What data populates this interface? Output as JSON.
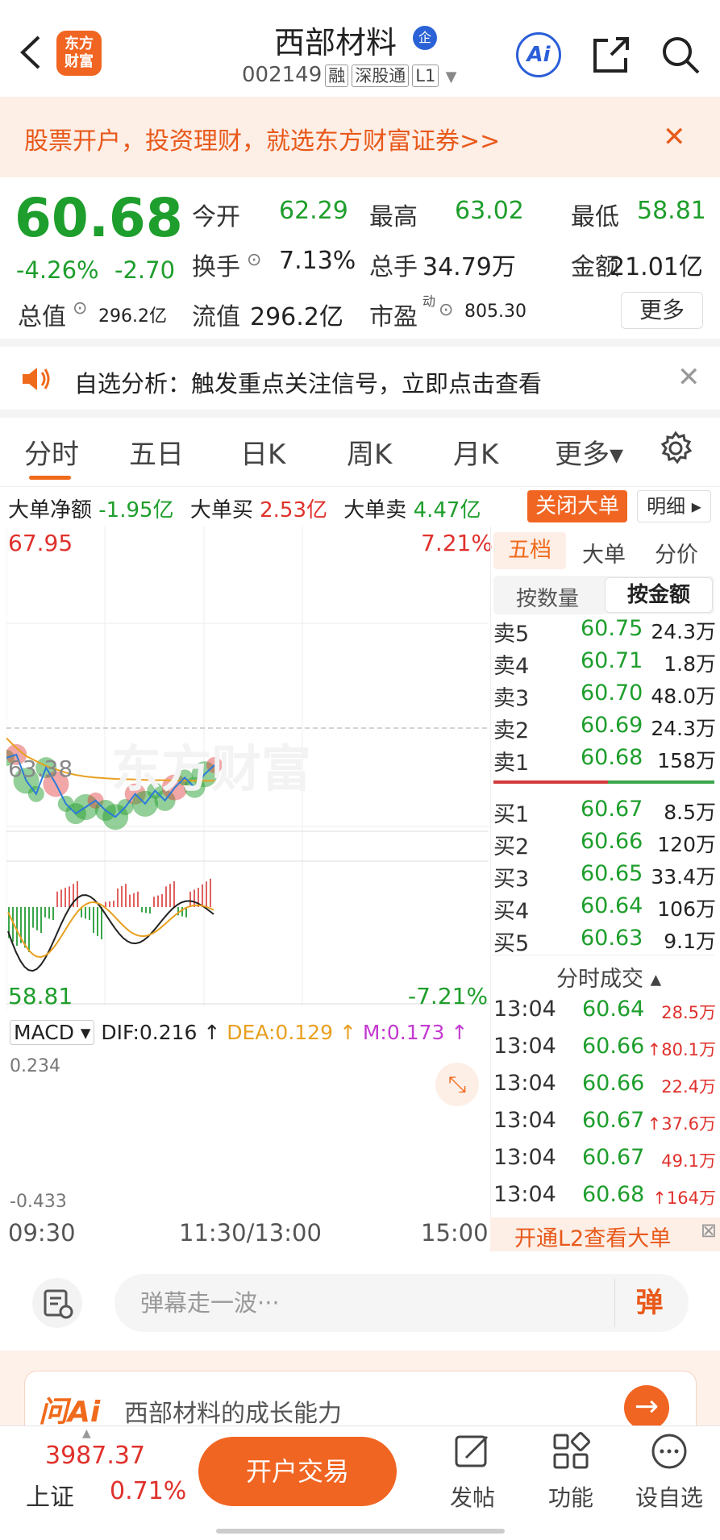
{
  "header": {
    "logo_line1": "东方",
    "logo_line2": "财富",
    "stock_name": "西部材料",
    "enterprise_badge": "企",
    "stock_code": "002149",
    "tags": [
      "融",
      "深股通",
      "L1"
    ],
    "ai_label": "Ai"
  },
  "promo": {
    "text": "股票开户，投资理财，就选东方财富证券>>",
    "close": "✕"
  },
  "quote": {
    "price": "60.68",
    "change_pct": "-4.26%",
    "change_abs": "-2.70",
    "open_label": "今开",
    "open": "62.29",
    "high_label": "最高",
    "high": "63.02",
    "low_label": "最低",
    "low": "58.81",
    "turnover_label": "换手",
    "turnover": "7.13%",
    "volume_label": "总手",
    "volume": "34.79万",
    "amount_label": "金额",
    "amount": "21.01亿",
    "mktcap_label": "总值",
    "mktcap": "296.2亿",
    "float_label": "流值",
    "float_cap": "296.2亿",
    "pe_label": "市盈",
    "pe_sup": "动",
    "pe": "805.30",
    "more_label": "更多"
  },
  "alert": {
    "text": "自选分析：触发重点关注信号，立即点击查看",
    "close": "✕"
  },
  "tabs": [
    "分时",
    "五日",
    "日K",
    "周K",
    "月K",
    "更多▾"
  ],
  "big_order": {
    "net_label": "大单净额",
    "net": "-1.95亿",
    "buy_label": "大单买",
    "buy": "2.53亿",
    "sell_label": "大单卖",
    "sell": "4.47亿",
    "close_button": "关闭大单",
    "detail_button": "明细 ▸"
  },
  "chart": {
    "top_price": "67.95",
    "top_pct": "7.21%",
    "mid_price": "63.38",
    "bottom_price": "58.81",
    "bottom_pct": "-7.21%",
    "watermark": "东方财富",
    "macd_label": "MACD ▾",
    "dif": "DIF:0.216 ↑",
    "dea": "DEA:0.129 ↑",
    "m": "M:0.173 ↑",
    "macd_top": "0.234",
    "macd_bottom": "-0.433",
    "time_start": "09:30",
    "time_mid": "11:30/13:00",
    "time_end": "15:00"
  },
  "chart_data": {
    "type": "line",
    "title": "",
    "x": [
      "09:30",
      "11:30/13:00",
      "15:00"
    ],
    "ylim": [
      58.81,
      67.95
    ],
    "reference_price": 63.38,
    "series": [
      {
        "values": [
          60.9,
          61.0,
          60.2,
          59.8,
          60.6,
          60.1,
          59.5,
          59.2,
          59.4,
          59.6,
          59.3,
          59.1,
          59.4,
          59.8,
          59.5,
          59.9,
          59.6,
          60.0,
          60.3,
          60.0,
          60.4,
          60.68
        ]
      },
      {
        "values": [
          61.5,
          61.2,
          60.95,
          60.8,
          60.65,
          60.55,
          60.45,
          60.38,
          60.33,
          60.3,
          60.28,
          60.26,
          60.25,
          60.24,
          60.23,
          60.22,
          60.22,
          60.21,
          60.21,
          60.2,
          60.2,
          60.2
        ]
      }
    ]
  },
  "order_book": {
    "tabs": [
      "五档",
      "大单",
      "分价"
    ],
    "sub_tabs": [
      "按数量",
      "按金额"
    ],
    "asks": [
      {
        "label": "卖5",
        "price": "60.75",
        "vol": "24.3万"
      },
      {
        "label": "卖4",
        "price": "60.71",
        "vol": "1.8万"
      },
      {
        "label": "卖3",
        "price": "60.70",
        "vol": "48.0万"
      },
      {
        "label": "卖2",
        "price": "60.69",
        "vol": "24.3万"
      },
      {
        "label": "卖1",
        "price": "60.68",
        "vol": "158万"
      }
    ],
    "bids": [
      {
        "label": "买1",
        "price": "60.67",
        "vol": "8.5万"
      },
      {
        "label": "买2",
        "price": "60.66",
        "vol": "120万"
      },
      {
        "label": "买3",
        "price": "60.65",
        "vol": "33.4万"
      },
      {
        "label": "买4",
        "price": "60.64",
        "vol": "106万"
      },
      {
        "label": "买5",
        "price": "60.63",
        "vol": "9.1万"
      }
    ],
    "trades_title": "分时成交 ▴",
    "trades": [
      {
        "time": "13:04",
        "price": "60.64",
        "vol": "28.5万",
        "up": ""
      },
      {
        "time": "13:04",
        "price": "60.66",
        "vol": "80.1万",
        "up": "↑"
      },
      {
        "time": "13:04",
        "price": "60.66",
        "vol": "22.4万",
        "up": ""
      },
      {
        "time": "13:04",
        "price": "60.67",
        "vol": "37.6万",
        "up": "↑"
      },
      {
        "time": "13:04",
        "price": "60.67",
        "vol": "49.1万",
        "up": ""
      },
      {
        "time": "13:04",
        "price": "60.68",
        "vol": "164万",
        "up": "↑"
      }
    ],
    "l2_banner": "开通L2查看大单"
  },
  "danmaku": {
    "placeholder": "弹幕走一波···",
    "send": "弹"
  },
  "ai_card": {
    "logo": "问Ai",
    "text": "西部材料的成长能力",
    "arrow": "→"
  },
  "bottom": {
    "index_value": "3987.37",
    "index_name": "上证",
    "index_pct": "0.71%",
    "trade_button": "开户交易",
    "nav": [
      "发帖",
      "功能",
      "设自选"
    ]
  },
  "colors": {
    "up": "#e0312c",
    "down": "#1e9e2c",
    "brand": "#f16522"
  }
}
